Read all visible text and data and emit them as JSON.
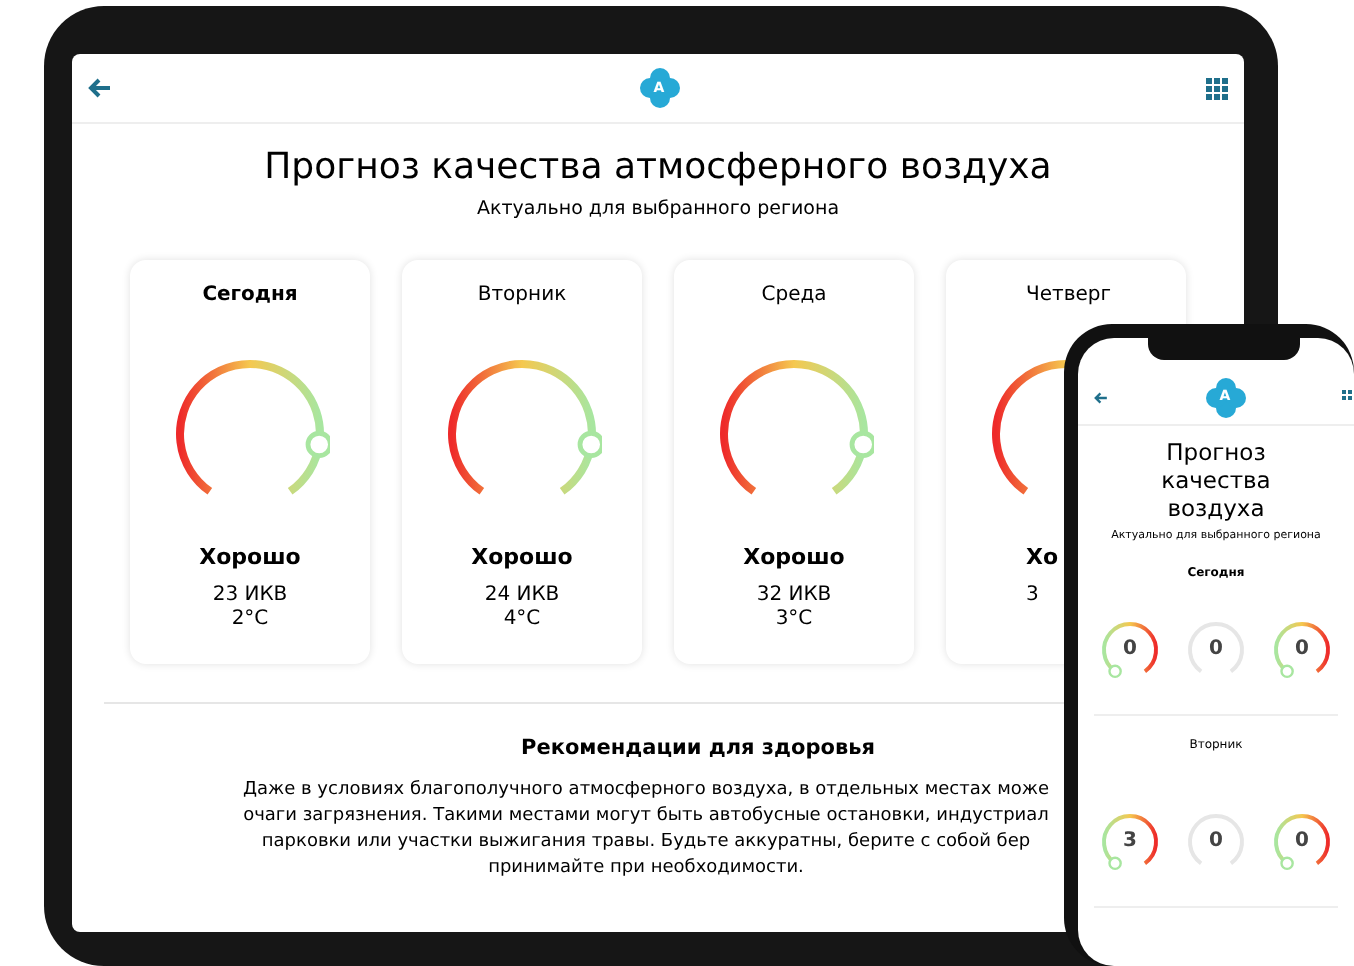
{
  "tablet": {
    "header": {
      "logo_text": "A"
    },
    "title": "Прогноз качества атмосферного воздуха",
    "subtitle": "Актуально для выбранного региона",
    "cards": [
      {
        "kind": "full",
        "day": "Сегодня",
        "selected": true,
        "status": "Хорошо",
        "aqi": "23 ИКВ",
        "temperature": "2°C"
      },
      {
        "kind": "full",
        "day": "Вторник",
        "selected": false,
        "status": "Хорошо",
        "aqi": "24 ИКВ",
        "temperature": "4°C"
      },
      {
        "kind": "full",
        "day": "Среда",
        "selected": false,
        "status": "Хорошо",
        "aqi": "32 ИКВ",
        "temperature": "3°C"
      },
      {
        "kind": "partial",
        "day": "Четверг",
        "selected": false,
        "status": "Хо",
        "aqi": "3"
      }
    ],
    "recommendations": {
      "title": "Рекомендации для здоровья",
      "lines": [
        "Даже в условиях благополучного атмосферного воздуха, в отдельных местах може",
        "очаги загрязнения. Такими местами могут быть автобусные остановки, индустриал",
        "парковки или участки выжигания травы. Будьте аккуратны, берите с собой бер",
        "принимайте при необходимости."
      ]
    }
  },
  "phone": {
    "header": {
      "logo_text": "A"
    },
    "title": "Прогноз качества воздуха",
    "subtitle": "Актуально для выбранного региона",
    "days": [
      {
        "day": "Сегодня",
        "selected": true,
        "gauges": [
          {
            "kind": "color",
            "value": "0"
          },
          {
            "kind": "empty",
            "value": "0"
          },
          {
            "kind": "color",
            "value": "0"
          }
        ]
      },
      {
        "day": "Вторник",
        "selected": false,
        "gauges": [
          {
            "kind": "color",
            "value": "3"
          },
          {
            "kind": "empty",
            "value": "0"
          },
          {
            "kind": "color",
            "value": "0"
          }
        ]
      }
    ]
  }
}
